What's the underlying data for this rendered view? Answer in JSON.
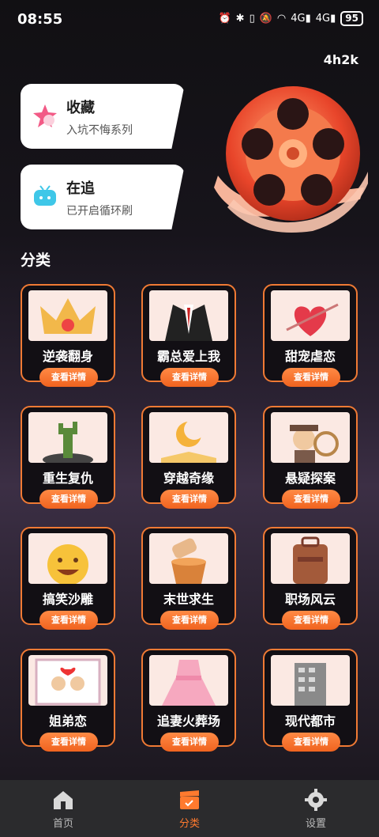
{
  "status": {
    "time": "08:55",
    "battery": "95",
    "net1": "4G",
    "net2": "4G"
  },
  "header": {
    "duration": "4h2k"
  },
  "cards": [
    {
      "title": "收藏",
      "subtitle": "入坑不悔系列"
    },
    {
      "title": "在追",
      "subtitle": "已开启循环刷"
    }
  ],
  "section_title": "分类",
  "detail_label": "查看详情",
  "categories": [
    {
      "name": "逆袭翻身",
      "icon": "crown-icon"
    },
    {
      "name": "霸总爱上我",
      "icon": "suit-icon"
    },
    {
      "name": "甜宠虐恋",
      "icon": "heart-arrow-icon"
    },
    {
      "name": "重生复仇",
      "icon": "zombie-hand-icon"
    },
    {
      "name": "穿越奇缘",
      "icon": "moon-book-icon"
    },
    {
      "name": "悬疑探案",
      "icon": "detective-icon"
    },
    {
      "name": "搞笑沙雕",
      "icon": "laughing-face-icon"
    },
    {
      "name": "末世求生",
      "icon": "bucket-icon"
    },
    {
      "name": "职场风云",
      "icon": "briefcase-icon"
    },
    {
      "name": "姐弟恋",
      "icon": "couple-photo-icon"
    },
    {
      "name": "追妻火葬场",
      "icon": "pink-dress-icon"
    },
    {
      "name": "现代都市",
      "icon": "building-icon"
    }
  ],
  "tabs": [
    {
      "label": "首页",
      "icon": "home-icon"
    },
    {
      "label": "分类",
      "icon": "clapperboard-icon"
    },
    {
      "label": "设置",
      "icon": "gear-icon"
    }
  ],
  "colors": {
    "accent": "#f07a34",
    "tab_active": "#ff7a2e"
  }
}
